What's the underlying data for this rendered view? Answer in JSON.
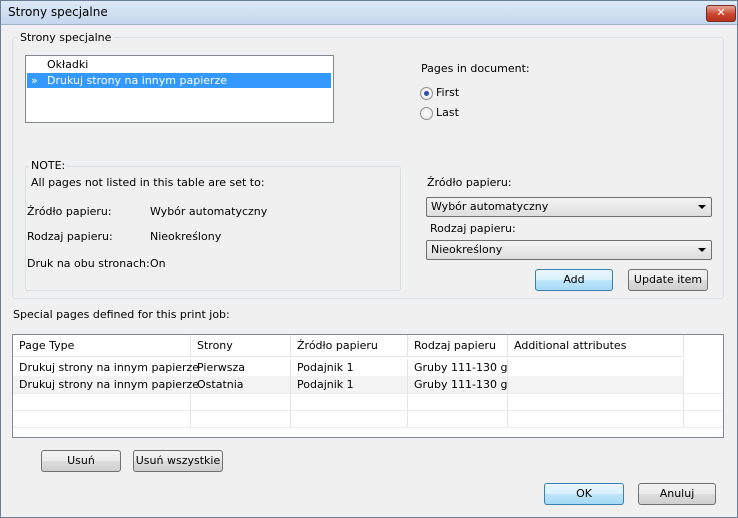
{
  "window": {
    "title": "Strony specjalne",
    "close_symbol": "✕"
  },
  "special_pages_group": {
    "legend": "Strony specjalne",
    "items": [
      {
        "label": "Okładki",
        "selected": false
      },
      {
        "label": "Drukuj strony na innym papierze",
        "selected": true,
        "marker": "»"
      }
    ]
  },
  "pages_in_document": {
    "label": "Pages in document:",
    "options": [
      {
        "label": "First",
        "checked": true
      },
      {
        "label": "Last",
        "checked": false
      }
    ]
  },
  "note": {
    "legend": "NOTE:",
    "intro": "All pages not listed in this table are set to:",
    "rows": [
      {
        "key": "Źródło papieru:",
        "value": "Wybór automatyczny"
      },
      {
        "key": "Rodzaj papieru:",
        "value": "Nieokreślony"
      },
      {
        "key": "Druk na obu stronach:",
        "value": "On"
      }
    ]
  },
  "settings": {
    "source_label": "Źródło papieru:",
    "source_value": "Wybór automatyczny",
    "type_label": "Rodzaj papieru:",
    "type_value": "Nieokreślony",
    "add_button": "Add",
    "update_button": "Update item"
  },
  "table": {
    "caption": "Special pages defined for this print job:",
    "columns": [
      "Page Type",
      "Strony",
      "Źródło papieru",
      "Rodzaj papieru",
      "Additional attributes"
    ],
    "rows": [
      [
        "Drukuj strony na innym papierze",
        "Pierwsza",
        "Podajnik 1",
        "Gruby 111-130 g",
        ""
      ],
      [
        "Drukuj strony na innym papierze",
        "Ostatnia",
        "Podajnik 1",
        "Gruby 111-130 g",
        ""
      ]
    ]
  },
  "buttons": {
    "remove": "Usuń",
    "remove_all": "Usuń wszystkie",
    "ok": "OK",
    "cancel": "Anuluj"
  }
}
